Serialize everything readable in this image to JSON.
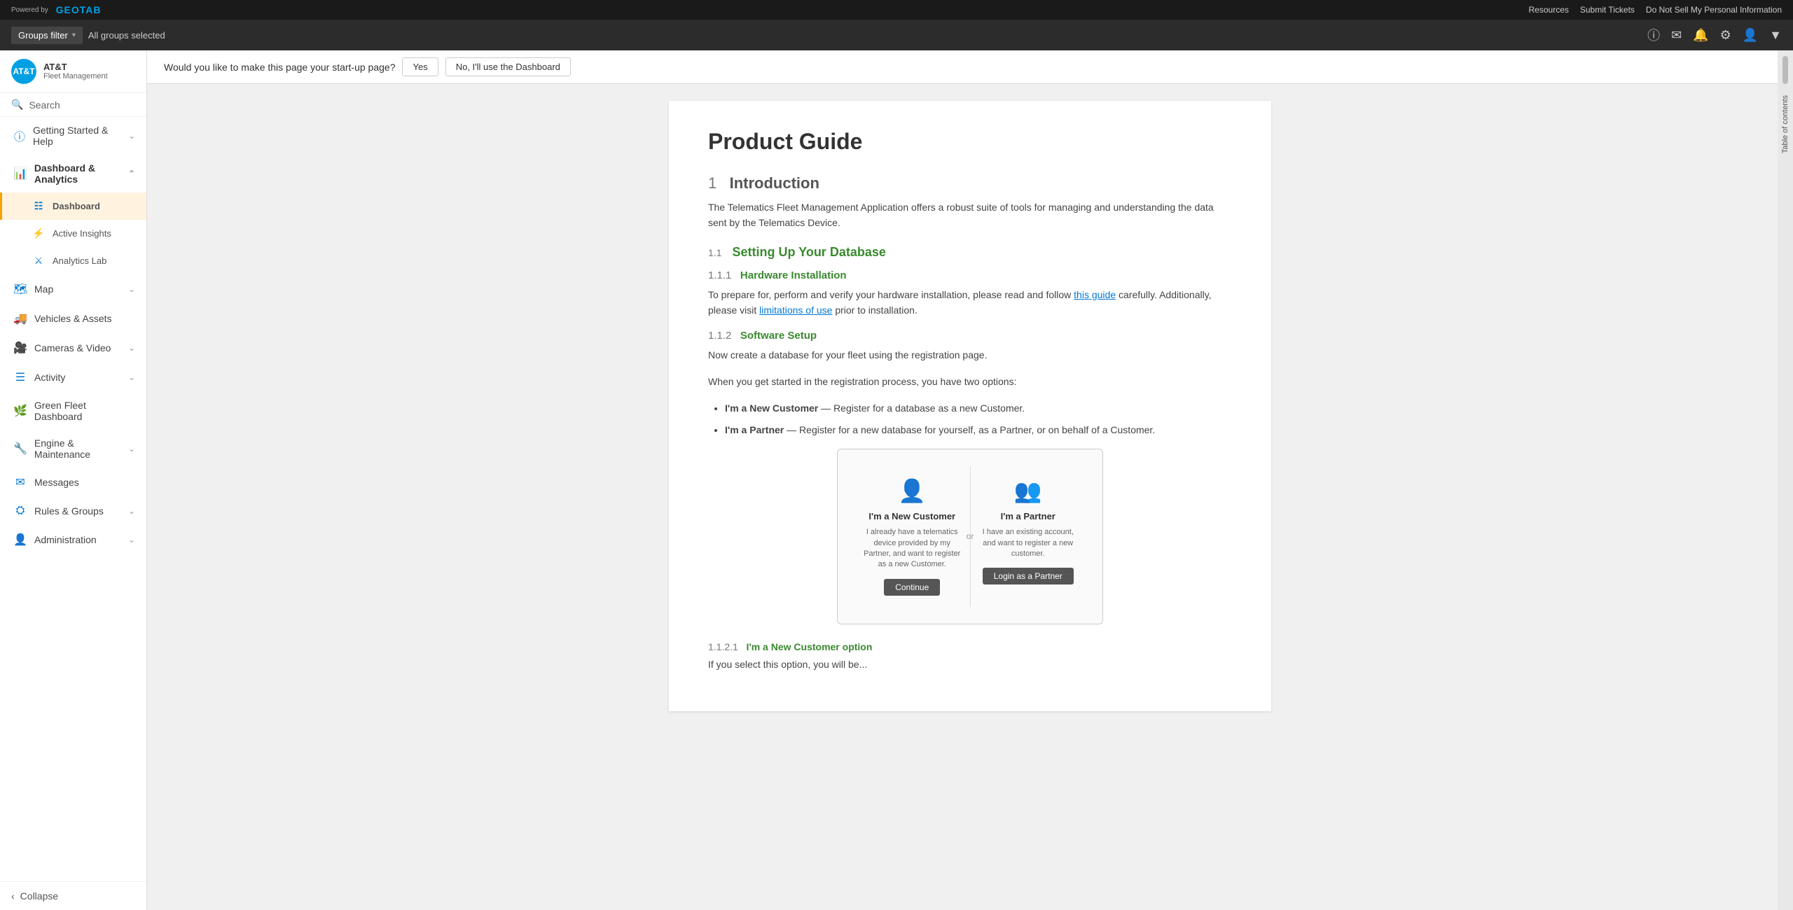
{
  "topbar": {
    "powered_by": "Powered by",
    "logo": "GEOTAB",
    "links": [
      "Resources",
      "Submit Tickets",
      "Do Not Sell My Personal Information"
    ]
  },
  "navbar": {
    "groups_filter_label": "Groups filter",
    "groups_selected": "All groups selected",
    "dropdown_arrow": "▾"
  },
  "sidebar": {
    "brand_name": "AT&T",
    "brand_sub": "Fleet Management",
    "search_placeholder": "Search",
    "items": [
      {
        "id": "getting-started",
        "label": "Getting Started & Help",
        "icon": "circle-info",
        "has_chevron": true,
        "level": 0
      },
      {
        "id": "dashboard-analytics",
        "label": "Dashboard & Analytics",
        "icon": "chart-bar",
        "has_chevron": true,
        "level": 0,
        "expanded": true
      },
      {
        "id": "dashboard",
        "label": "Dashboard",
        "icon": "grid",
        "level": 1,
        "active": true
      },
      {
        "id": "active-insights",
        "label": "Active Insights",
        "icon": "bolt",
        "level": 1
      },
      {
        "id": "analytics-lab",
        "label": "Analytics Lab",
        "icon": "flask",
        "level": 1
      },
      {
        "id": "map",
        "label": "Map",
        "icon": "map",
        "has_chevron": true,
        "level": 0
      },
      {
        "id": "vehicles-assets",
        "label": "Vehicles & Assets",
        "icon": "truck",
        "has_chevron": false,
        "level": 0
      },
      {
        "id": "cameras-video",
        "label": "Cameras & Video",
        "icon": "video",
        "has_chevron": true,
        "level": 0
      },
      {
        "id": "activity",
        "label": "Activity",
        "icon": "list",
        "has_chevron": true,
        "level": 0
      },
      {
        "id": "green-fleet",
        "label": "Green Fleet Dashboard",
        "icon": "leaf",
        "has_chevron": false,
        "level": 0
      },
      {
        "id": "engine-maintenance",
        "label": "Engine & Maintenance",
        "icon": "wrench",
        "has_chevron": true,
        "level": 0
      },
      {
        "id": "messages",
        "label": "Messages",
        "icon": "envelope",
        "has_chevron": false,
        "level": 0
      },
      {
        "id": "rules-groups",
        "label": "Rules & Groups",
        "icon": "sliders",
        "has_chevron": true,
        "level": 0
      },
      {
        "id": "administration",
        "label": "Administration",
        "icon": "user-gear",
        "has_chevron": true,
        "level": 0
      }
    ],
    "collapse_label": "Collapse"
  },
  "startup_bar": {
    "question": "Would you like to make this page your start-up page?",
    "yes_label": "Yes",
    "no_label": "No, I'll use the Dashboard"
  },
  "doc": {
    "title": "Product Guide",
    "section1": {
      "num": "1",
      "label": "Introduction",
      "body": "The Telematics Fleet Management Application offers a robust suite of tools for managing and understanding the data sent by the Telematics Device."
    },
    "section1_1": {
      "num": "1.1",
      "label": "Setting Up Your Database"
    },
    "section1_1_1": {
      "num": "1.1.1",
      "label": "Hardware Installation",
      "body_pre": "To prepare for, perform and verify your hardware installation, please read and follow ",
      "link1": "this guide",
      "body_mid": " carefully. Additionally, please visit ",
      "link2": "limitations of use",
      "body_post": " prior to installation."
    },
    "section1_1_2": {
      "num": "1.1.2",
      "label": "Software Setup",
      "body1": "Now create a database for your fleet using the registration page.",
      "body2": "When you get started in the registration process, you have two options:",
      "option1_bold": "I'm a New Customer",
      "option1_rest": " — Register for a database as a new Customer.",
      "option2_bold": "I'm a Partner",
      "option2_rest": " — Register for a new database for yourself, as a Partner, or on behalf of a Customer."
    },
    "reg_new_customer": {
      "title": "I'm a New Customer",
      "desc": "I already have a telematics device provided by my Partner, and want to register as a new Customer.",
      "btn": "Continue"
    },
    "reg_partner": {
      "title": "I'm a Partner",
      "desc": "I have an existing account, and want to register a new customer.",
      "btn": "Login as a Partner",
      "divider": "or"
    },
    "section1_1_2_1": {
      "num": "1.1.2.1",
      "label": "I'm a New Customer option"
    },
    "section1_1_2_1_body": "If you select this option, you will be..."
  },
  "toc": {
    "label": "Table of contents"
  }
}
